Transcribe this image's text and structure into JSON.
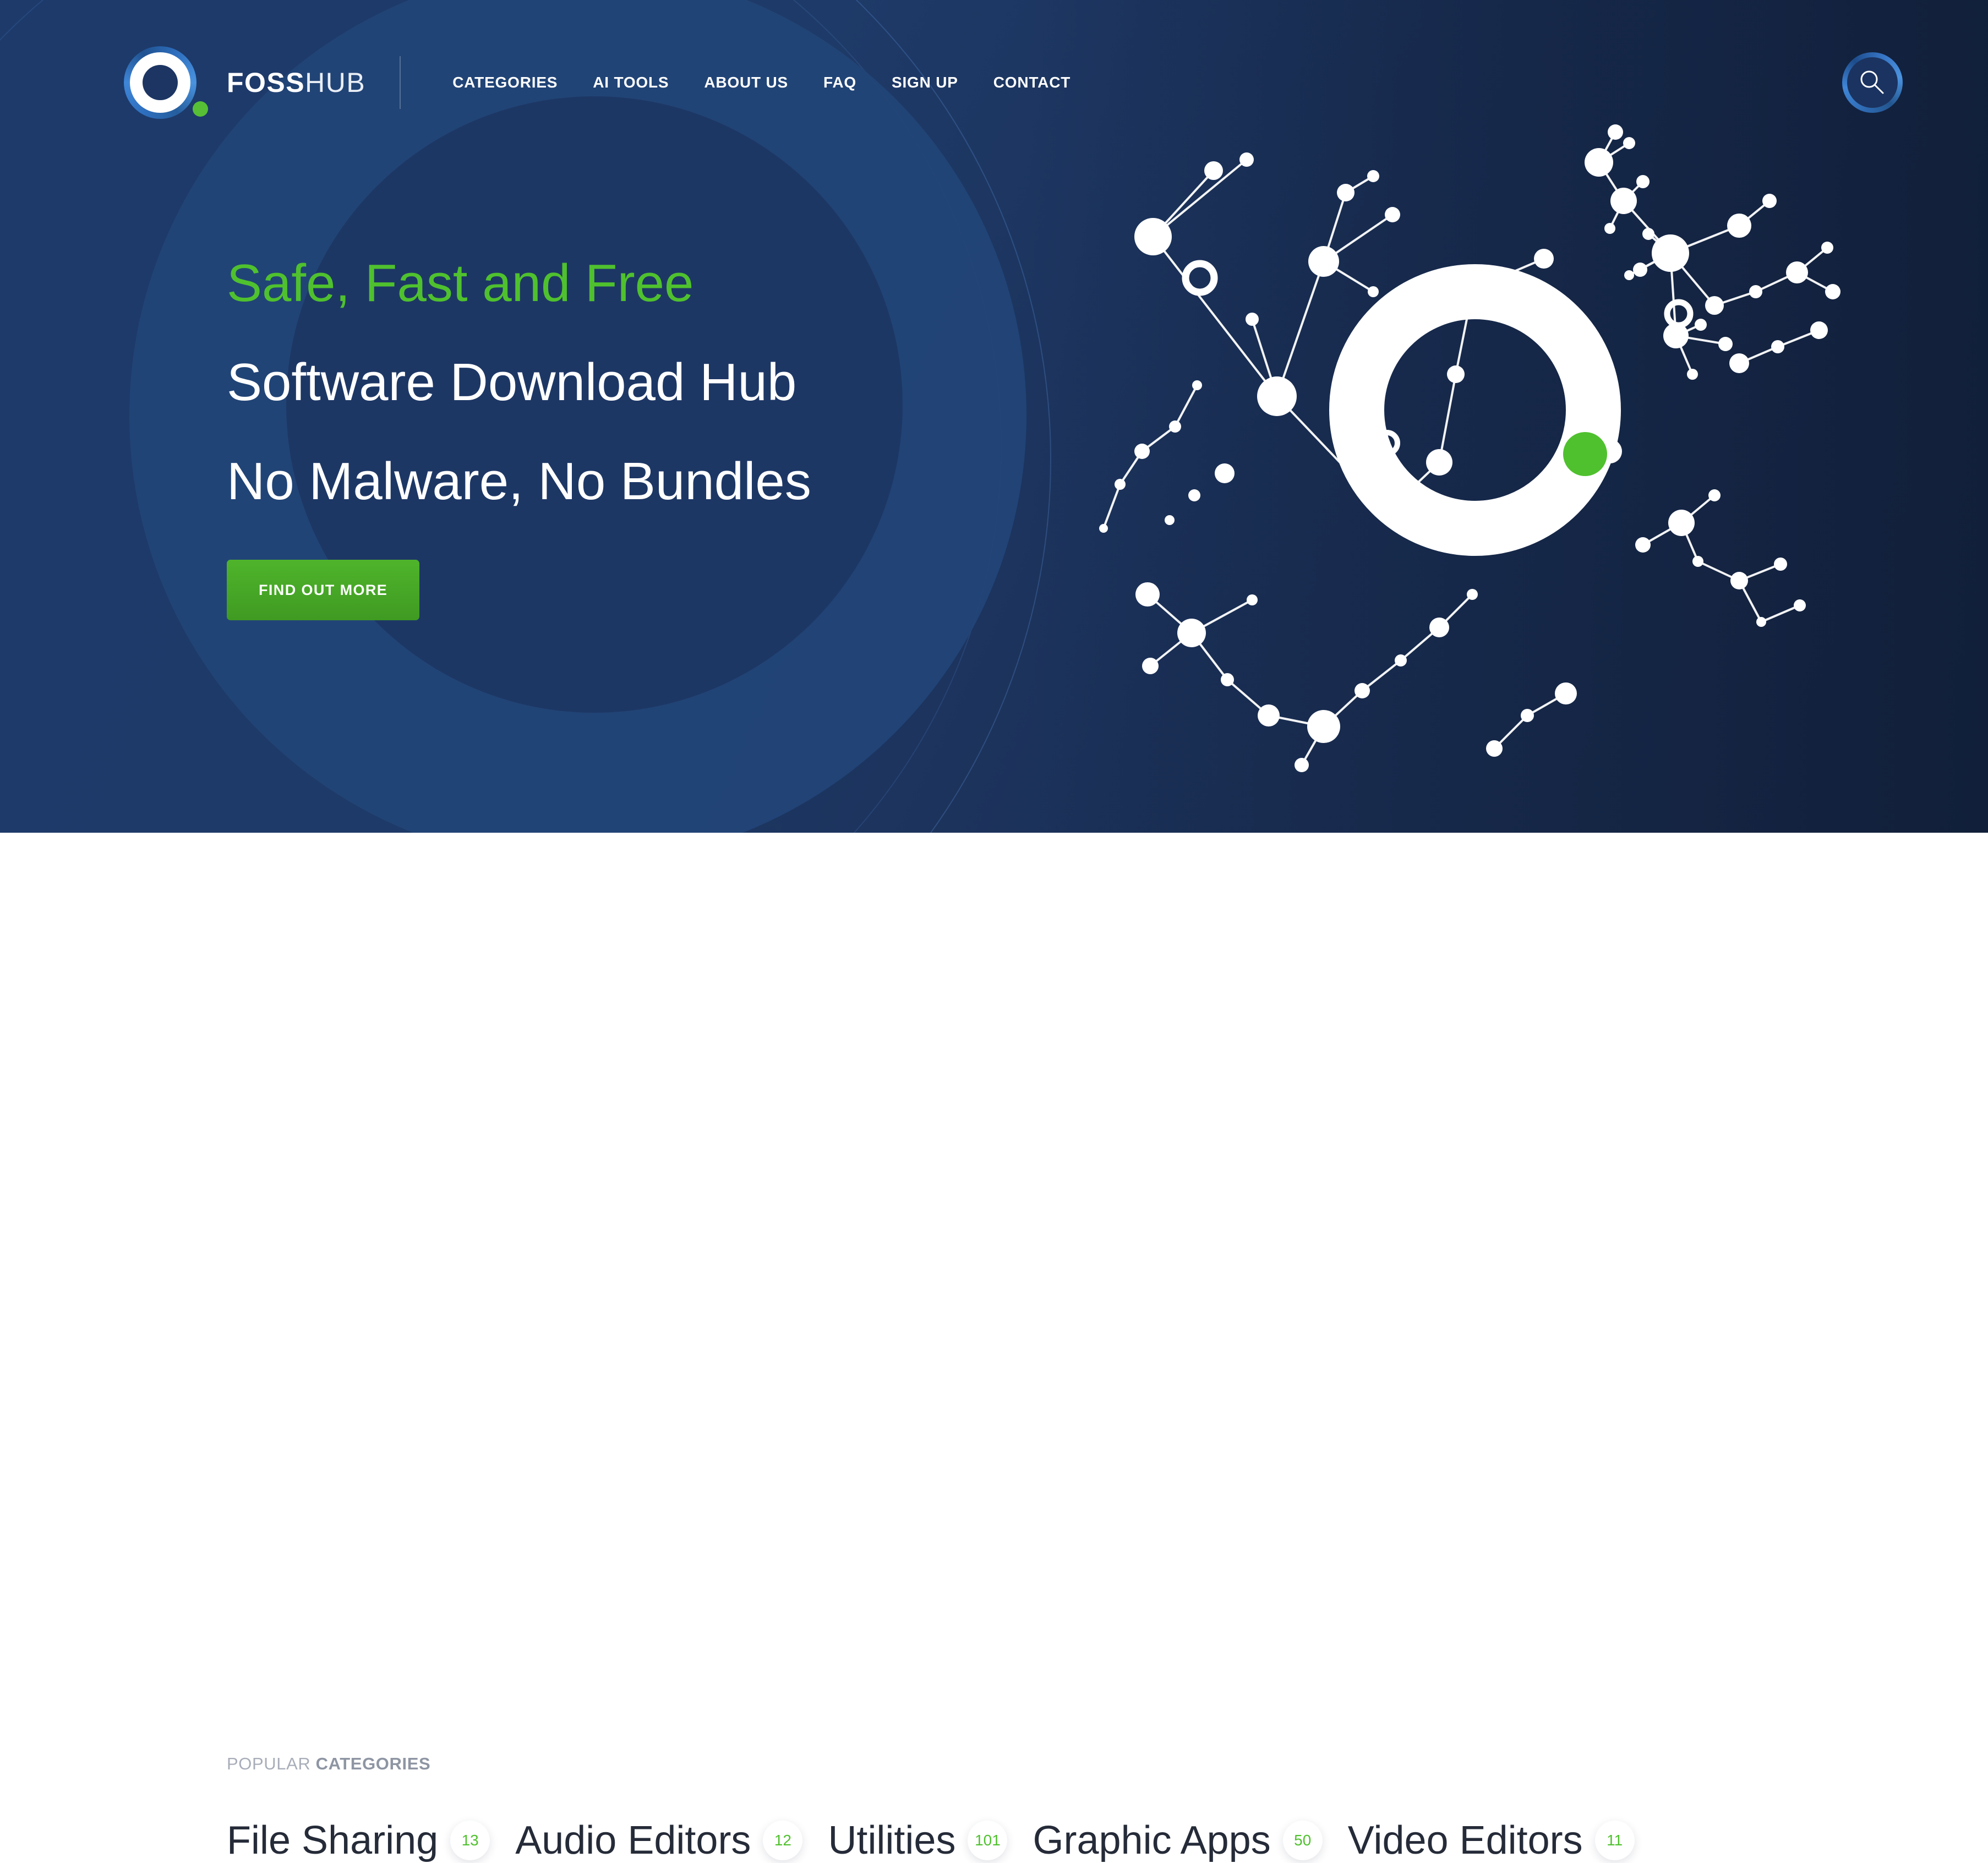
{
  "brand": {
    "name_bold": "FOSS",
    "name_light": "HUB",
    "logo_icon": "fosshub-ring-logo"
  },
  "nav": {
    "items": [
      {
        "label": "CATEGORIES"
      },
      {
        "label": "AI TOOLS"
      },
      {
        "label": "ABOUT US"
      },
      {
        "label": "FAQ"
      },
      {
        "label": "SIGN UP"
      },
      {
        "label": "CONTACT"
      }
    ],
    "search_icon": "search-icon"
  },
  "hero": {
    "headline_accent": "Safe, Fast and Free",
    "headline_line2": "Software Download Hub",
    "headline_line3": "No Malware, No Bundles",
    "cta_label": "FIND OUT MORE",
    "graphic": "network-nodes-ring"
  },
  "categories": {
    "label_regular": "POPULAR ",
    "label_bold": "CATEGORIES",
    "items": [
      {
        "name": "File Sharing",
        "count": "13"
      },
      {
        "name": "Audio Editors",
        "count": "12"
      },
      {
        "name": "Utilities",
        "count": "101"
      },
      {
        "name": "Graphic Apps",
        "count": "50"
      },
      {
        "name": "Video Editors",
        "count": "11"
      }
    ]
  },
  "colors": {
    "navy": "#1c3563",
    "navy_dark": "#16294c",
    "navy_mid": "#224577",
    "green": "#4fc12e",
    "green_button": "#4fb42b",
    "white": "#ffffff",
    "text_dark": "#252b38",
    "text_muted": "#a8adb9"
  }
}
